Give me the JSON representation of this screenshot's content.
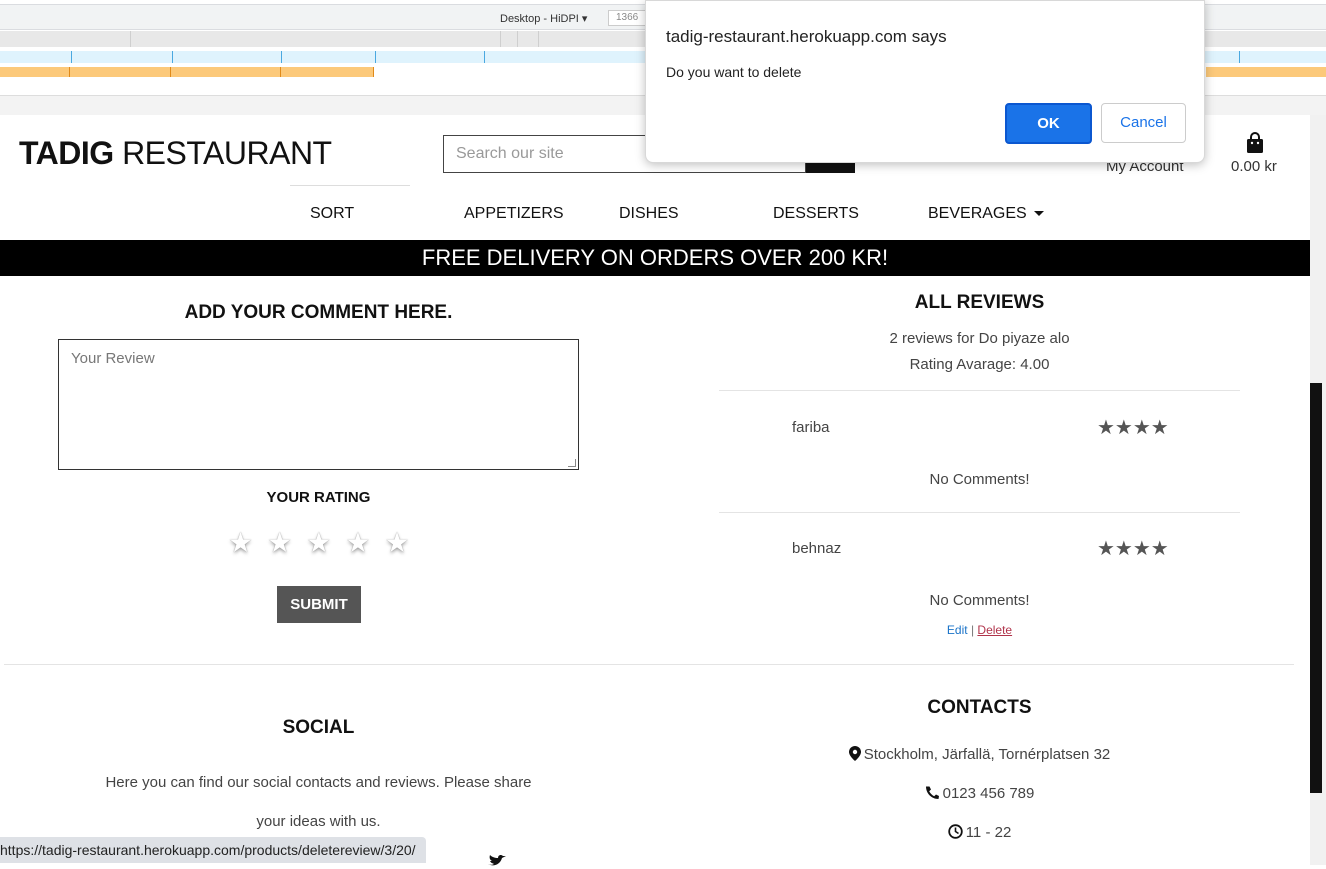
{
  "devtools": {
    "device_label": "Desktop - HiDPI ▾",
    "width_value": "1366"
  },
  "header": {
    "logo_bold": "TADIG",
    "logo_rest": " RESTAURANT",
    "search_placeholder": "Search our site",
    "account_label": "My Account",
    "cart_total": "0.00 kr"
  },
  "nav": {
    "items": [
      "SORT",
      "APPETIZERS",
      "DISHES",
      "DESSERTS",
      "BEVERAGES"
    ]
  },
  "banner": "FREE DELIVERY ON ORDERS OVER 200 KR!",
  "add_review": {
    "heading": "ADD YOUR COMMENT HERE.",
    "placeholder": "Your Review",
    "rating_label": "YOUR RATING",
    "rating_value": 0,
    "rating_max": 5,
    "submit_label": "SUBMIT"
  },
  "reviews": {
    "heading": "ALL REVIEWS",
    "count_text": "2 reviews for Do piyaze alo",
    "average_text": "Rating Avarage: 4.00",
    "items": [
      {
        "name": "fariba",
        "stars": "★★★★",
        "rating": 4,
        "comment": "No Comments!"
      },
      {
        "name": "behnaz",
        "stars": "★★★★",
        "rating": 4,
        "comment": "No Comments!",
        "edit_label": "Edit",
        "separator": "|",
        "delete_label": "Delete"
      }
    ]
  },
  "social": {
    "heading": "SOCIAL",
    "line1": "Here you can find our social contacts and reviews. Please share",
    "line2": "your ideas with us."
  },
  "contacts": {
    "heading": "CONTACTS",
    "address": "Stockholm, Järfallä, Tornérplatsen 32",
    "phone": "0123 456 789",
    "hours": "11 - 22"
  },
  "status_bar": {
    "url": "https://tadig-restaurant.herokuapp.com/products/deletereview/3/20/"
  },
  "dialog": {
    "title": "tadig-restaurant.herokuapp.com says",
    "message": "Do you want to delete",
    "ok_label": "OK",
    "cancel_label": "Cancel"
  },
  "colors": {
    "primary_button": "#1a73e8",
    "banner_bg": "#000000",
    "delete_link": "#b0334a",
    "edit_link": "#1a73c8"
  }
}
